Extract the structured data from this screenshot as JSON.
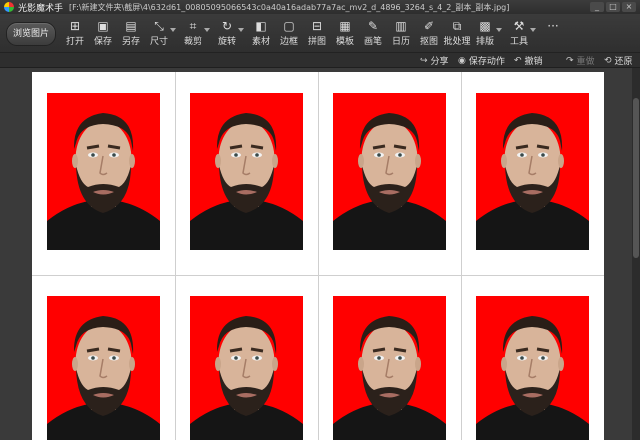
{
  "window": {
    "app_name": "光影魔术手",
    "file_path": "[F:\\新建文件夹\\截屏\\4\\632d61_00805095066543c0a40a16adab77a7ac_mv2_d_4896_3264_s_4_2_副本_副本.jpg]",
    "minimize": "_",
    "maximize": "□",
    "close": "×"
  },
  "toolbar": {
    "browse_label": "浏览图片",
    "tools": [
      {
        "label": "打开",
        "icon": "open-icon"
      },
      {
        "label": "保存",
        "icon": "save-icon"
      },
      {
        "label": "另存",
        "icon": "save-as-icon"
      },
      {
        "label": "尺寸",
        "icon": "resize-icon"
      },
      {
        "label": "裁剪",
        "icon": "crop-icon"
      },
      {
        "label": "旋转",
        "icon": "rotate-icon"
      },
      {
        "label": "素材",
        "icon": "material-icon"
      },
      {
        "label": "边框",
        "icon": "border-icon"
      },
      {
        "label": "拼图",
        "icon": "collage-icon"
      },
      {
        "label": "模板",
        "icon": "template-icon"
      },
      {
        "label": "画笔",
        "icon": "brush-icon"
      },
      {
        "label": "日历",
        "icon": "calendar-icon"
      },
      {
        "label": "抠图",
        "icon": "cutout-icon"
      },
      {
        "label": "批处理",
        "icon": "batch-icon"
      },
      {
        "label": "排版",
        "icon": "layout-icon"
      },
      {
        "label": "工具",
        "icon": "tools-icon"
      }
    ],
    "more": "···"
  },
  "subbar": {
    "share": "分享",
    "save_action": "保存动作",
    "undo": "撤销",
    "redo": "重做",
    "restore": "还原"
  },
  "canvas": {
    "photo_background_color": "#ff0000",
    "grid_columns": 4,
    "grid_rows_visible": 2
  }
}
